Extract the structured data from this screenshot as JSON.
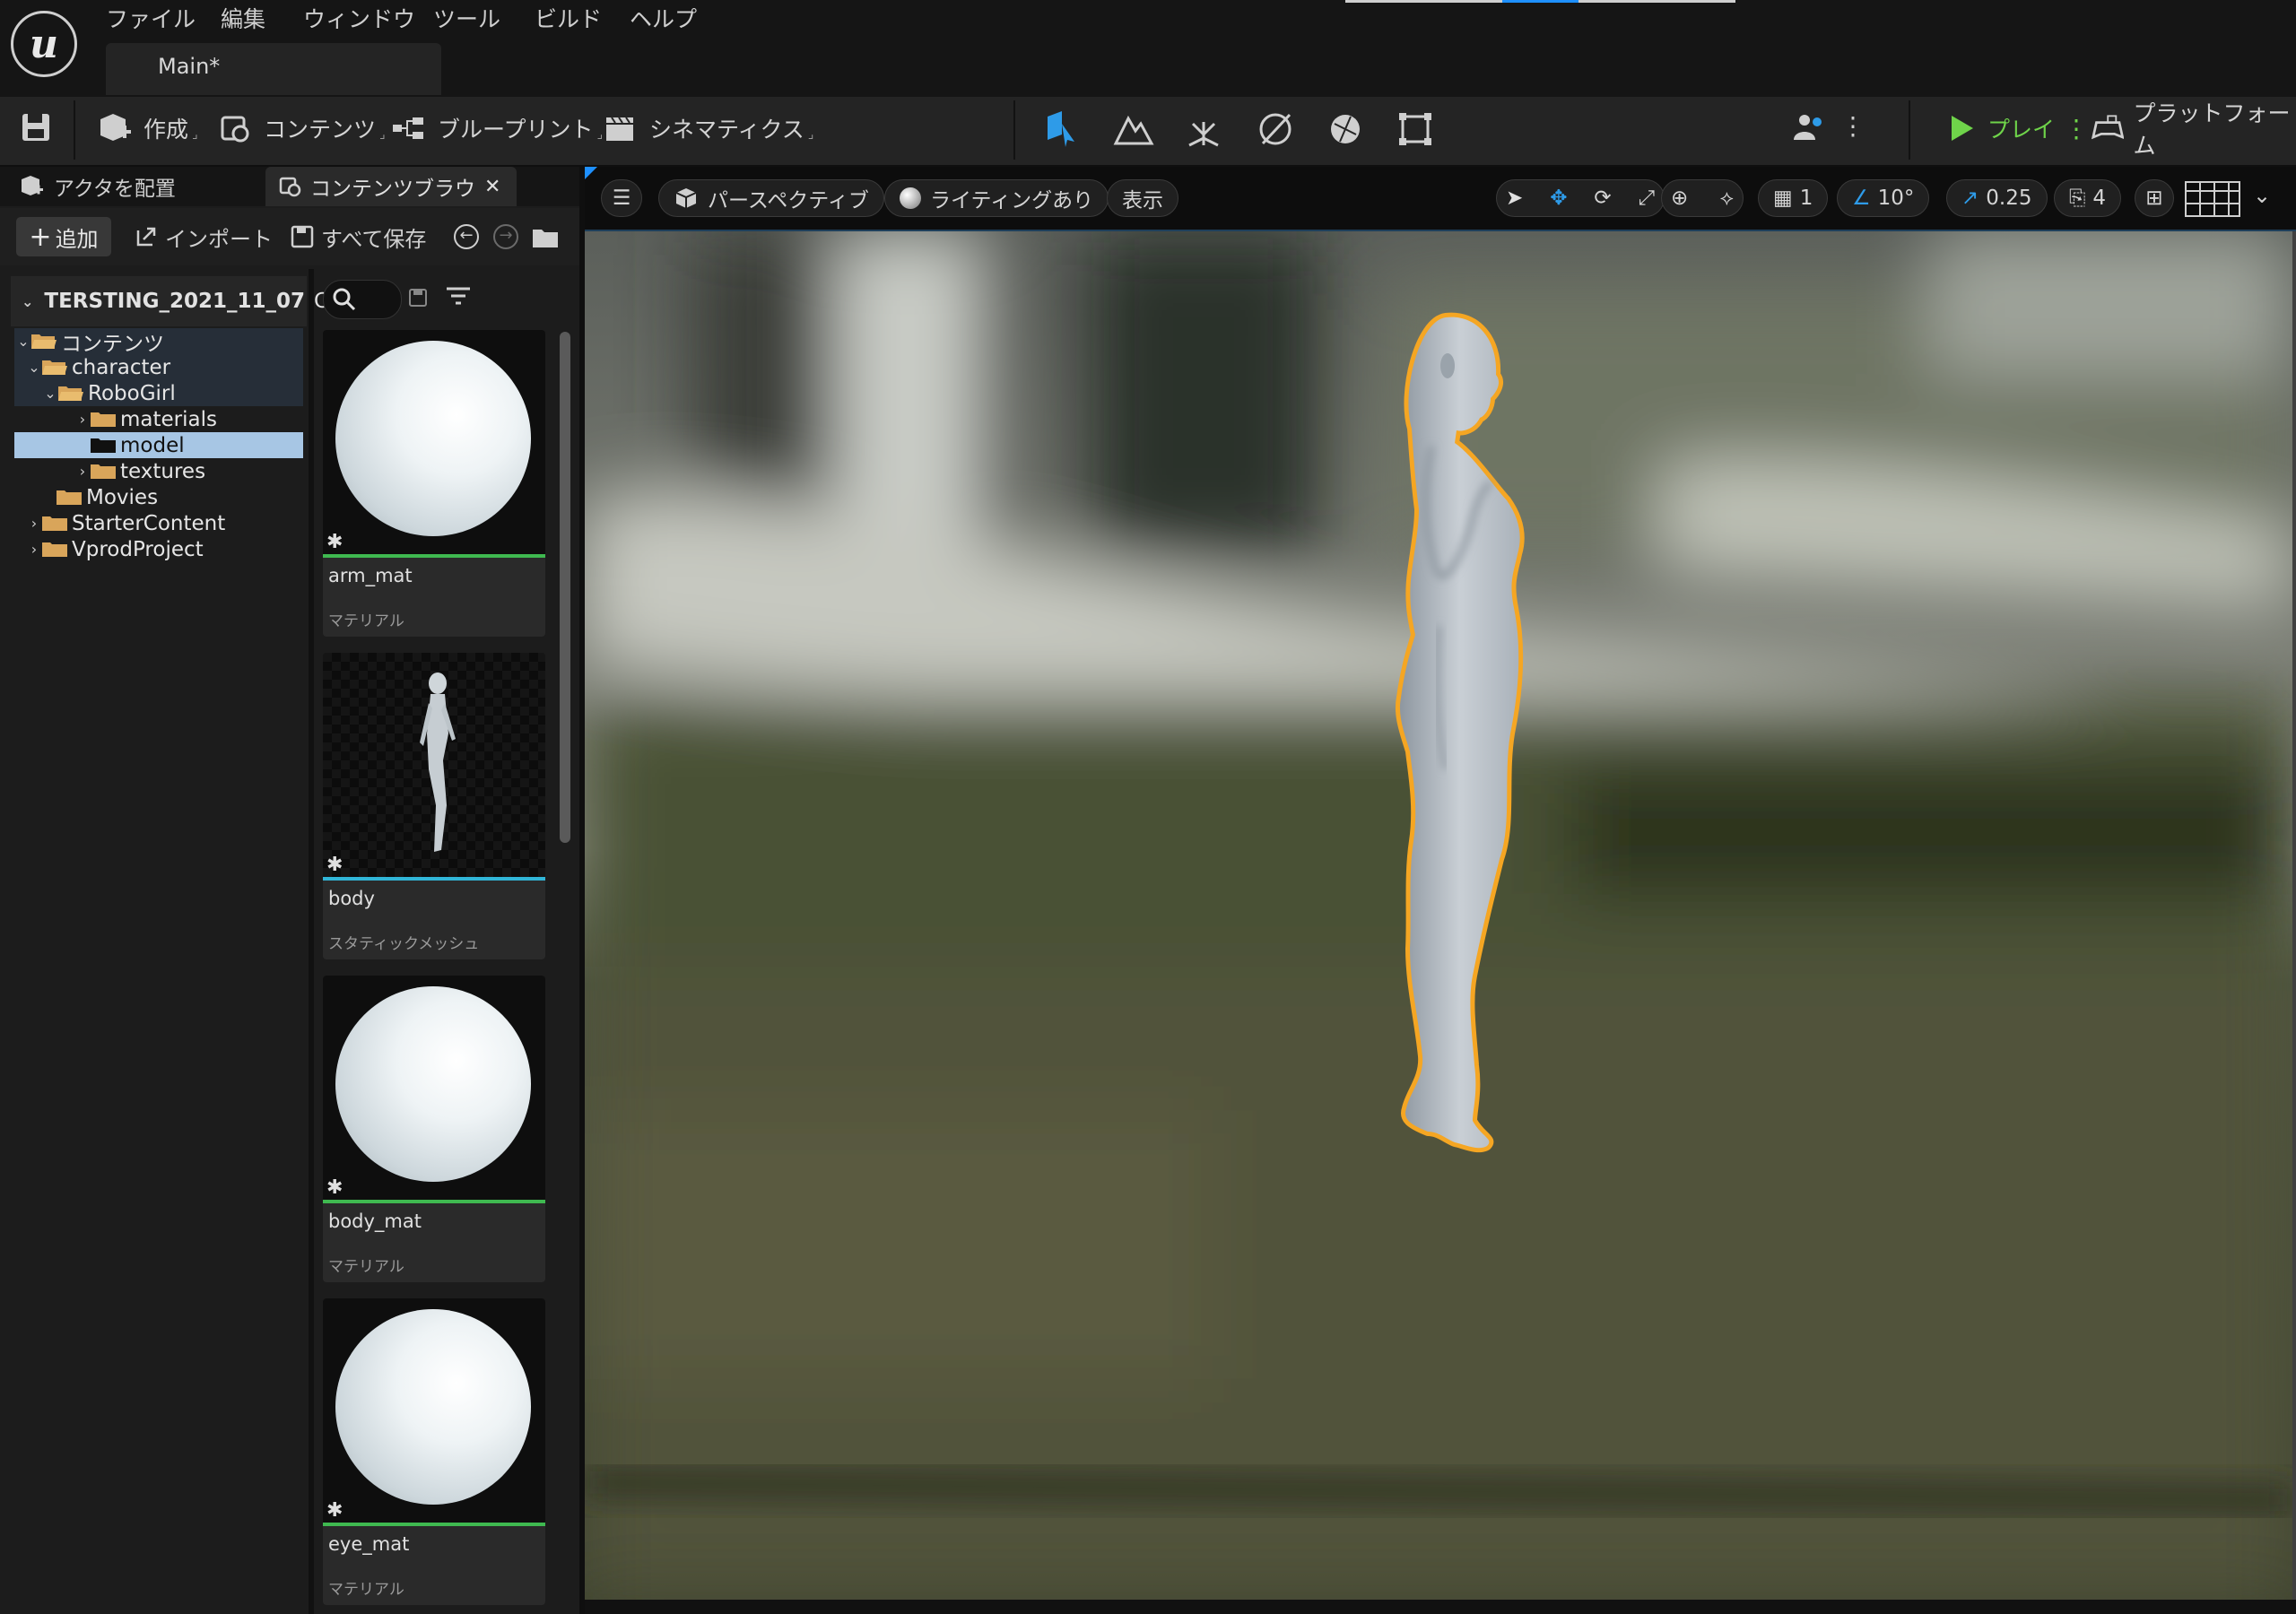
{
  "menu": {
    "items": [
      "ファイル",
      "編集",
      "ウィンドウ",
      "ツール",
      "ビルド",
      "ヘルプ"
    ],
    "doc_tab": "Main*"
  },
  "toolbar": {
    "create": "作成",
    "content": "コンテンツ",
    "blueprint": "ブループリント",
    "cinematics": "シネマティクス",
    "play": "プレイ",
    "platform": "プラットフォーム"
  },
  "left_panel": {
    "tab_place_actors": "アクタを配置",
    "tab_content_browser": "コンテンツブラウ",
    "add_button": "追加",
    "import_button": "インポート",
    "save_all_button": "すべて保存",
    "project_root": "TERSTING_2021_11_07",
    "tree": [
      {
        "label": "コンテンツ",
        "state": "expanded",
        "highlight": true
      },
      {
        "label": "character",
        "state": "expanded",
        "highlight": true
      },
      {
        "label": "RoboGirl",
        "state": "expanded",
        "highlight": true
      },
      {
        "label": "materials",
        "state": "collapsed"
      },
      {
        "label": "model",
        "state": "leaf",
        "selected": true
      },
      {
        "label": "textures",
        "state": "collapsed"
      },
      {
        "label": "Movies",
        "state": "leaf"
      },
      {
        "label": "StarterContent",
        "state": "collapsed"
      },
      {
        "label": "VprodProject",
        "state": "collapsed"
      }
    ],
    "assets": [
      {
        "name": "arm_mat",
        "type": "マテリアル",
        "bar_color": "#3fb950"
      },
      {
        "name": "body",
        "type": "スタティックメッシュ",
        "bar_color": "#31b6d8"
      },
      {
        "name": "body_mat",
        "type": "マテリアル",
        "bar_color": "#3fb950"
      },
      {
        "name": "eye_mat",
        "type": "マテリアル",
        "bar_color": "#3fb950"
      }
    ]
  },
  "viewport": {
    "perspective": "パースペクティブ",
    "lighting": "ライティングあり",
    "show": "表示",
    "grid_snap": "1",
    "angle_snap": "10°",
    "scale_snap": "0.25",
    "camera_speed": "4",
    "selection_outline_color": "#f5a623"
  },
  "colors": {
    "accent_blue": "#1e90ff",
    "play_green": "#6fd44a",
    "selected_row": "#a7c6e4"
  }
}
